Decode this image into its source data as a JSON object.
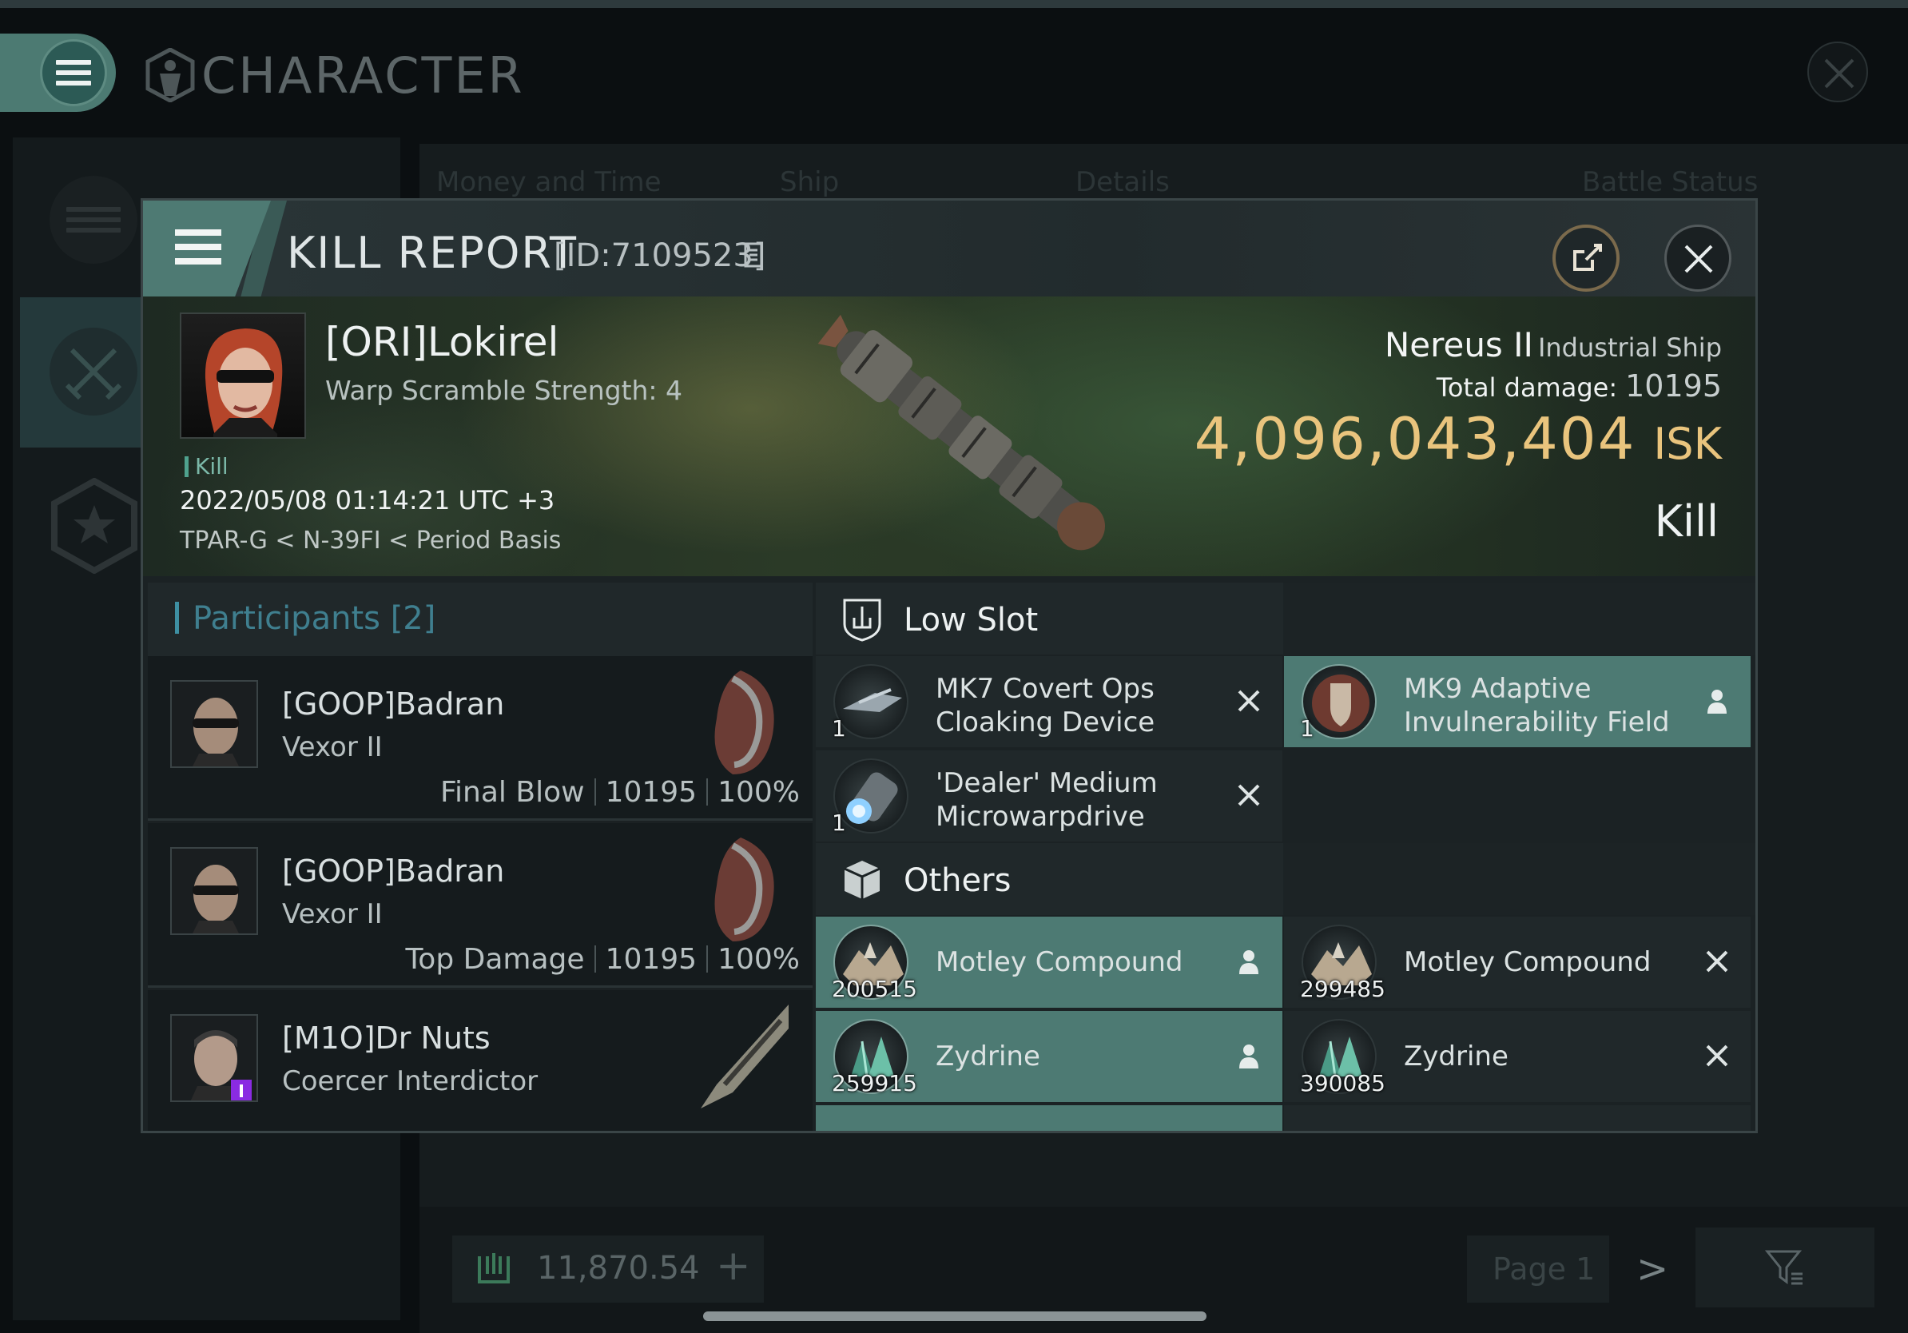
{
  "app": {
    "title": "CHARACTER"
  },
  "background": {
    "columns": [
      "Money and Time",
      "Ship",
      "Details",
      "Battle Status"
    ],
    "wallet_value": "11,870.54",
    "wallet_plus": "+",
    "page_label": "Page 1",
    "next_glyph": ">"
  },
  "kill_report": {
    "title": "KILL REPORT",
    "id": "[ID:7109523]",
    "victim": {
      "name": "[ORI]Lokirel",
      "subtitle": "Warp Scramble Strength: 4",
      "tag": "Kill",
      "datetime": "2022/05/08 01:14:21 UTC +3",
      "location": "TPAR-G < N-39FI < Period Basis"
    },
    "ship": {
      "name": "Nereus II",
      "class": "Industrial Ship",
      "damage_label": "Total damage:",
      "damage_value": "10195",
      "isk_value": "4,096,043,404",
      "isk_unit": "ISK",
      "result": "Kill"
    },
    "accent_color": "#4d7a73",
    "isk_color": "#e9c47d"
  },
  "participants": {
    "label": "Participants",
    "count": "[2]",
    "list": [
      {
        "name": "[GOOP]Badran",
        "ship": "Vexor II",
        "role": "Final Blow",
        "damage": "10195",
        "percent": "100%"
      },
      {
        "name": "[GOOP]Badran",
        "ship": "Vexor II",
        "role": "Top Damage",
        "damage": "10195",
        "percent": "100%"
      },
      {
        "name": "[M1O]Dr Nuts",
        "ship": "Coercer Interdictor",
        "role": "",
        "damage": "",
        "percent": ""
      }
    ]
  },
  "items": {
    "low_slot_title": "Low Slot",
    "others_title": "Others",
    "low_slot": [
      {
        "name_1": "MK7 Covert Ops",
        "name_2": "Cloaking Device",
        "qty": "1",
        "status": "destroyed"
      },
      {
        "name_1": "MK9 Adaptive",
        "name_2": "Invulnerability Field",
        "qty": "1",
        "status": "dropped"
      },
      {
        "name_1": "'Dealer' Medium",
        "name_2": "Microwarpdrive",
        "qty": "1",
        "status": "destroyed"
      }
    ],
    "others": [
      {
        "name": "Motley Compound",
        "qty": "200515",
        "status": "dropped"
      },
      {
        "name": "Motley Compound",
        "qty": "299485",
        "status": "destroyed"
      },
      {
        "name": "Zydrine",
        "qty": "259915",
        "status": "dropped"
      },
      {
        "name": "Zydrine",
        "qty": "390085",
        "status": "destroyed"
      }
    ]
  }
}
